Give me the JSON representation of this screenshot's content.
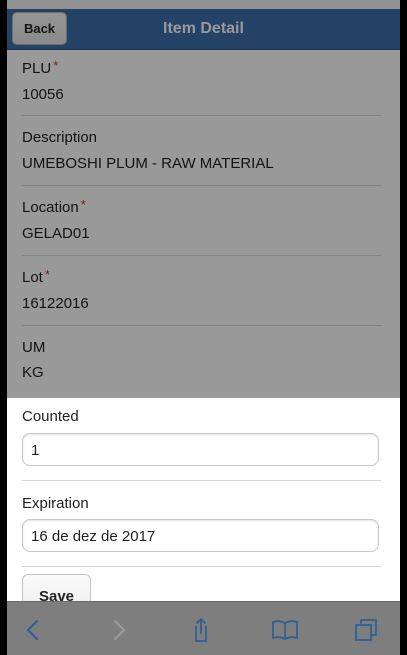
{
  "header": {
    "title": "Item Detail",
    "back_label": "Back"
  },
  "fields": {
    "plu": {
      "label": "PLU",
      "value": "10056",
      "required_mark": "*"
    },
    "description": {
      "label": "Description",
      "value": "UMEBOSHI PLUM - RAW MATERIAL"
    },
    "location": {
      "label": "Location",
      "value": "GELAD01",
      "required_mark": "*"
    },
    "lot": {
      "label": "Lot",
      "value": "16122016",
      "required_mark": "*"
    },
    "um": {
      "label": "UM",
      "value": "KG"
    },
    "counted": {
      "label": "Counted",
      "value": "1"
    },
    "expiration": {
      "label": "Expiration",
      "value": "16 de dez de 2017"
    }
  },
  "actions": {
    "save_label": "Save"
  },
  "toolbar": {
    "icons": [
      "back-arrow-icon",
      "forward-arrow-icon",
      "share-icon",
      "bookmarks-icon",
      "tabs-icon"
    ]
  },
  "colors": {
    "header_bg": "#3b6ea8",
    "required": "#c0392b",
    "toolbar_bg": "#7e7e7e"
  }
}
